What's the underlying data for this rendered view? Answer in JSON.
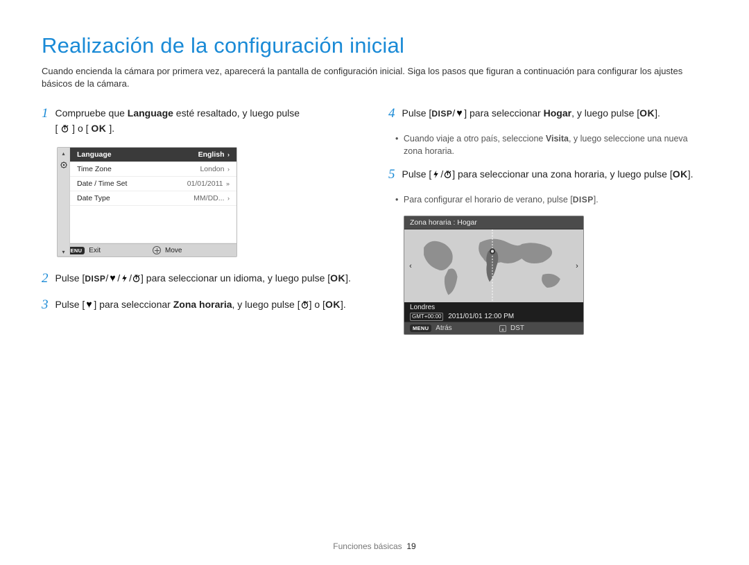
{
  "title": "Realización de la configuración inicial",
  "intro": "Cuando encienda la cámara por primera vez, aparecerá la pantalla de configuración inicial. Siga los pasos que figuran a continuación para configurar los ajustes básicos de la cámara.",
  "steps": {
    "s1a": "Compruebe que ",
    "s1b": "Language",
    "s1c": " esté resaltado, y luego pulse",
    "s1d": "[",
    "s1e": "] o [",
    "s1f": "].",
    "s2a": "Pulse [",
    "s2b": "] para seleccionar un idioma, y luego pulse [",
    "s2c": "].",
    "s3a": "Pulse [",
    "s3b": "] para seleccionar ",
    "s3c": "Zona horaria",
    "s3d": ", y luego pulse [",
    "s3e": "] o [",
    "s3f": "].",
    "s4a": "Pulse [",
    "s4b": "] para seleccionar ",
    "s4c": "Hogar",
    "s4d": ", y luego pulse [",
    "s4e": "].",
    "s4note_a": "Cuando viaje a otro país, seleccione ",
    "s4note_b": "Visita",
    "s4note_c": ", y luego seleccione una nueva zona horaria.",
    "s5a": "Pulse [",
    "s5b": "] para seleccionar una zona horaria, y luego pulse [",
    "s5c": "].",
    "s5note_a": "Para configurar el horario de verano, pulse [",
    "s5note_b": "]."
  },
  "keys": {
    "ok": "OK",
    "disp": "DISP",
    "menu": "MENU"
  },
  "nums": {
    "n1": "1",
    "n2": "2",
    "n3": "3",
    "n4": "4",
    "n5": "5"
  },
  "cam_list": {
    "rows": [
      {
        "label": "Language",
        "value": "English"
      },
      {
        "label": "Time Zone",
        "value": "London"
      },
      {
        "label": "Date / Time Set",
        "value": "01/01/2011"
      },
      {
        "label": "Date Type",
        "value": "MM/DD..."
      }
    ],
    "footer_left": "Exit",
    "footer_right": "Move"
  },
  "cam_map": {
    "title": "Zona horaria : Hogar",
    "city": "Londres",
    "gmt_tag": "GMT+00:00",
    "datetime": "2011/01/01 12:00 PM",
    "footer_left": "Atrás",
    "footer_right": "DST"
  },
  "footer_label": "Funciones básicas",
  "footer_page": "19"
}
